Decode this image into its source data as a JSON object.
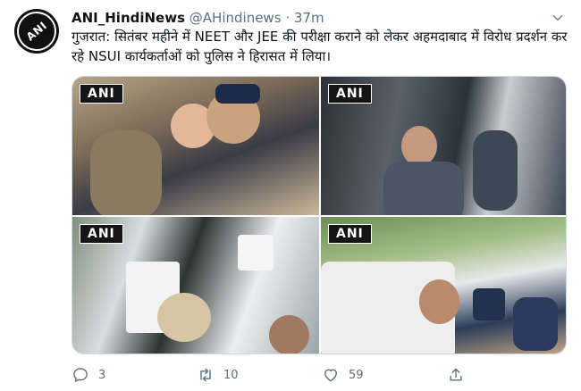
{
  "tweet": {
    "author_name": "ANI_HindiNews",
    "author_handle": "@AHindinews",
    "separator": "·",
    "time": "37m",
    "avatar_label": "ANI",
    "text": "गुजरात: सितंबर महीने में NEET और JEE की परीक्षा कराने को लेकर अहमदाबाद में विरोध प्रदर्शन कर रहे NSUI कार्यकर्ताओं को पुलिस ने हिरासत में लिया।",
    "media": [
      {
        "watermark": "ANI",
        "icon": "photo-protest-police"
      },
      {
        "watermark": "ANI",
        "icon": "photo-bus-crowd"
      },
      {
        "watermark": "ANI",
        "icon": "photo-detained-in-bus"
      },
      {
        "watermark": "ANI",
        "icon": "photo-police-van"
      }
    ],
    "actions": {
      "reply_count": "3",
      "retweet_count": "10",
      "like_count": "59"
    }
  },
  "colors": {
    "text": "#0f1419",
    "secondary": "#5b7083",
    "border": "#cfd9de"
  }
}
